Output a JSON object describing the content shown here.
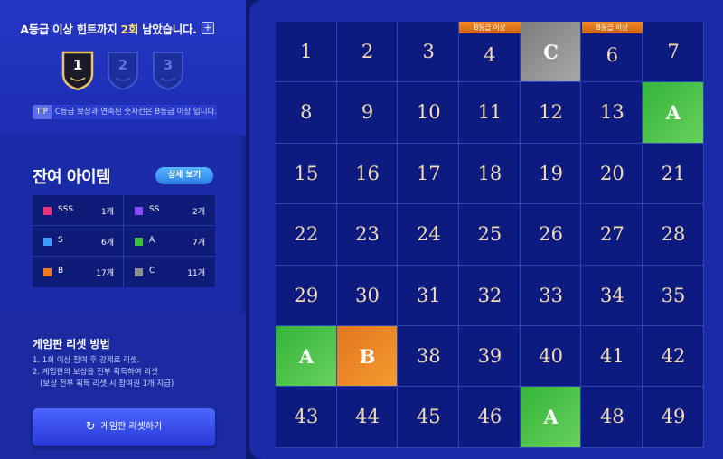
{
  "hint": {
    "text_before": "A등급 이상 힌트까지 ",
    "text_highlight": "2회",
    "text_after": " 남았습니다.",
    "plus": "+",
    "badges": [
      "1",
      "2",
      "3"
    ],
    "tip_tag": "TIP",
    "tip_text": "C등급 보상과 연속된 숫자칸은 B등급 이상 입니다."
  },
  "remaining": {
    "title": "잔여 아이템",
    "detail_button": "상세 보기",
    "items": [
      {
        "name": "SSS",
        "count": "1개",
        "color": "#e8327a"
      },
      {
        "name": "SS",
        "count": "2개",
        "color": "#8a4bff"
      },
      {
        "name": "S",
        "count": "6개",
        "color": "#3f9bff"
      },
      {
        "name": "A",
        "count": "7개",
        "color": "#3bbf3c"
      },
      {
        "name": "B",
        "count": "17개",
        "color": "#f07a1b"
      },
      {
        "name": "C",
        "count": "11개",
        "color": "#8d8d8d"
      }
    ]
  },
  "reset": {
    "title": "게임판 리셋 방법",
    "lines": [
      "1. 1회 이상 참여 후 강제로 리셋.",
      "2. 게임판의 보상을 전부 획득하여 리셋",
      "   (보상 전부 획득 리셋 시 참여권 1개 지급)"
    ],
    "button": "게임판 리셋하기",
    "button_icon": "refresh-icon"
  },
  "board": {
    "cells": [
      {
        "t": "1"
      },
      {
        "t": "2"
      },
      {
        "t": "3"
      },
      {
        "t": "4",
        "label": "B등급 이상"
      },
      {
        "t": "C",
        "grade": "C"
      },
      {
        "t": "6",
        "label": "B등급 이상"
      },
      {
        "t": "7"
      },
      {
        "t": "8"
      },
      {
        "t": "9"
      },
      {
        "t": "10"
      },
      {
        "t": "11"
      },
      {
        "t": "12"
      },
      {
        "t": "13"
      },
      {
        "t": "A",
        "grade": "A"
      },
      {
        "t": "15"
      },
      {
        "t": "16"
      },
      {
        "t": "17"
      },
      {
        "t": "18"
      },
      {
        "t": "19"
      },
      {
        "t": "20"
      },
      {
        "t": "21"
      },
      {
        "t": "22"
      },
      {
        "t": "23"
      },
      {
        "t": "24"
      },
      {
        "t": "25"
      },
      {
        "t": "26"
      },
      {
        "t": "27"
      },
      {
        "t": "28"
      },
      {
        "t": "29"
      },
      {
        "t": "30"
      },
      {
        "t": "31"
      },
      {
        "t": "32"
      },
      {
        "t": "33"
      },
      {
        "t": "34"
      },
      {
        "t": "35"
      },
      {
        "t": "A",
        "grade": "A"
      },
      {
        "t": "B",
        "grade": "B"
      },
      {
        "t": "38"
      },
      {
        "t": "39"
      },
      {
        "t": "40"
      },
      {
        "t": "41"
      },
      {
        "t": "42"
      },
      {
        "t": "43"
      },
      {
        "t": "44"
      },
      {
        "t": "45"
      },
      {
        "t": "46"
      },
      {
        "t": "A",
        "grade": "A"
      },
      {
        "t": "48"
      },
      {
        "t": "49"
      }
    ]
  }
}
